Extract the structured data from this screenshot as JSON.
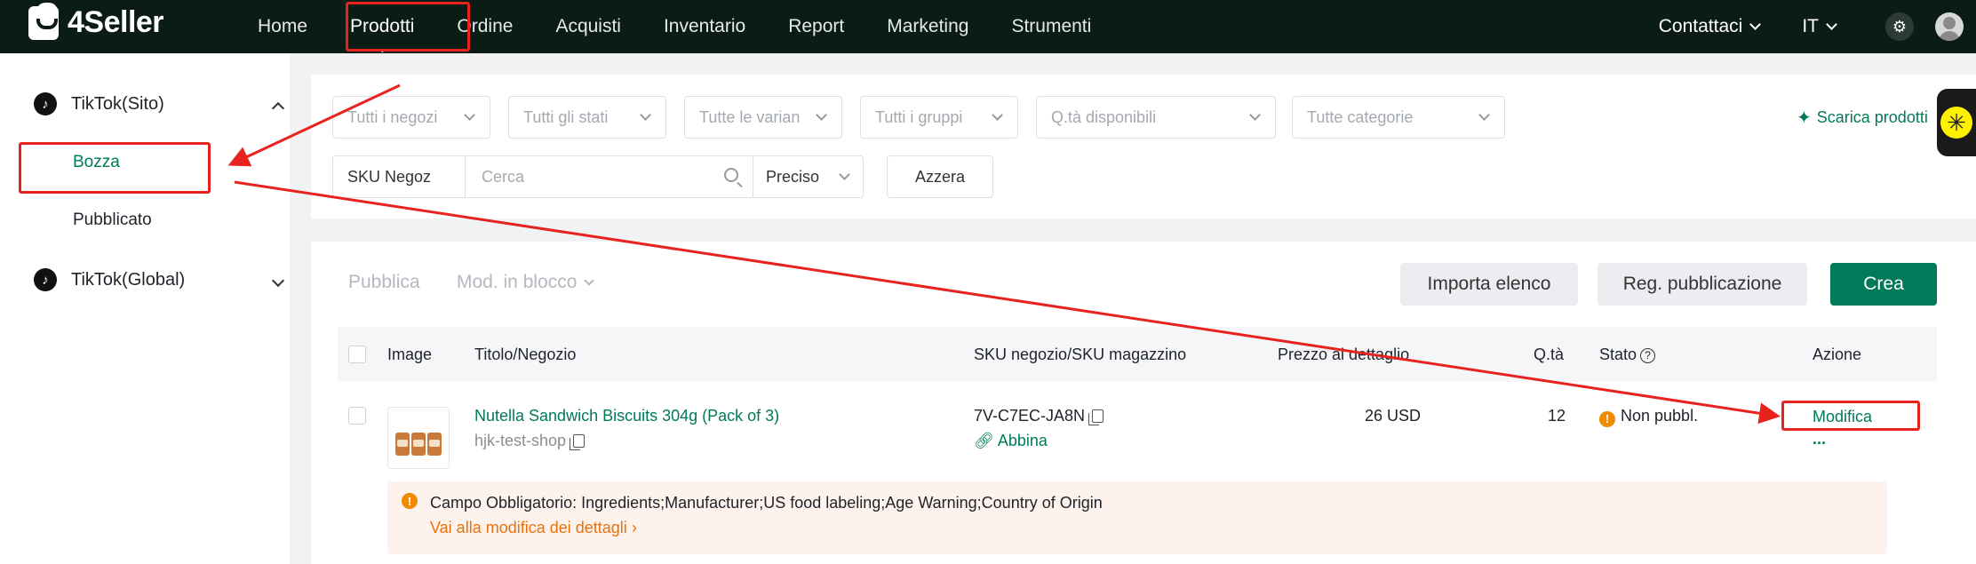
{
  "brand": {
    "name": "4Seller"
  },
  "topnav": {
    "items": [
      {
        "label": "Home"
      },
      {
        "label": "Prodotti",
        "active": true
      },
      {
        "label": "Ordine"
      },
      {
        "label": "Acquisti"
      },
      {
        "label": "Inventario"
      },
      {
        "label": "Report"
      },
      {
        "label": "Marketing"
      },
      {
        "label": "Strumenti"
      }
    ],
    "contact_label": "Contattaci",
    "language_label": "IT"
  },
  "sidebar": {
    "group1_label": "TikTok(Sito)",
    "group1_items": [
      "Bozza",
      "Pubblicato"
    ],
    "group2_label": "TikTok(Global)",
    "active_item": "Bozza"
  },
  "filters": {
    "dropdowns": [
      "Tutti i negozi",
      "Tutti gli stati",
      "Tutte le varian",
      "Tutti i gruppi",
      "Q.tà disponibili",
      "Tutte categorie"
    ],
    "search_field_select": "SKU Negoz",
    "search_placeholder": "Cerca",
    "match_select": "Preciso",
    "reset_label": "Azzera",
    "download_label": "Scarica prodotti"
  },
  "toolbar": {
    "publish_label": "Pubblica",
    "bulk_edit_label": "Mod. in blocco",
    "import_label": "Importa elenco",
    "log_label": "Reg. pubblicazione",
    "create_label": "Crea"
  },
  "table": {
    "columns": [
      "Image",
      "Titolo/Negozio",
      "SKU negozio/SKU magazzino",
      "Prezzo al dettaglio",
      "Q.tà",
      "Stato",
      "Azione"
    ],
    "rows": [
      {
        "title": "Nutella Sandwich Biscuits 304g (Pack of 3)",
        "shop": "hjk-test-shop",
        "sku": "7V-C7EC-JA8N",
        "match_label": "Abbina",
        "price": "26 USD",
        "qty": "12",
        "status": "Non pubbl.",
        "action_label": "Modifica",
        "more_label": "...",
        "alert_text": "Campo Obbligatorio: Ingredients;Manufacturer;US food labeling;Age Warning;Country of Origin",
        "alert_link": "Vai alla modifica dei dettagli"
      }
    ]
  },
  "colors": {
    "accent": "#007a5a",
    "topbar": "#0b1b16",
    "annotation": "#e8231f",
    "warning": "#f08a00"
  },
  "icons": [
    "logo-bag-icon",
    "gear-icon",
    "avatar",
    "tiktok-icon",
    "search-icon",
    "sparkle-icon",
    "copy-icon",
    "link-icon",
    "help-circle-icon",
    "warning-icon",
    "chevron-down-icon",
    "chevron-up-icon",
    "chat-search-icon"
  ]
}
